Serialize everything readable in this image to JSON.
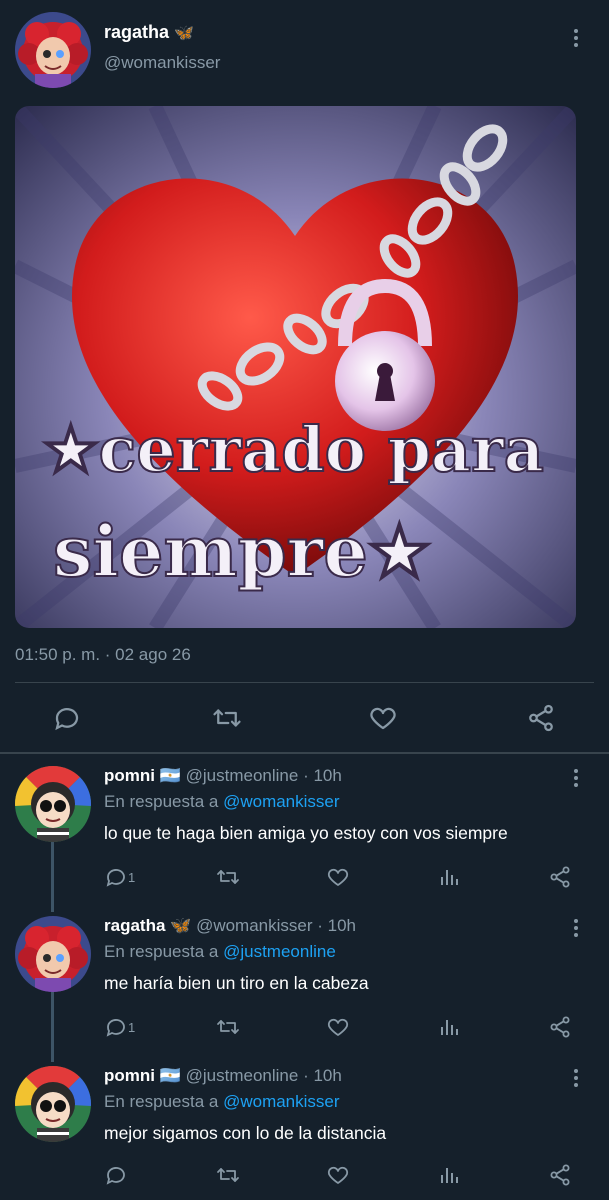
{
  "main_tweet": {
    "display_name": "ragatha",
    "name_emoji": "🦋",
    "handle": "@womankisser",
    "image": {
      "alt_text_line1": "★cerrado para",
      "alt_text_line2": "siempre★"
    },
    "timestamp": "01:50 p. m. · 02 ago 26",
    "actions": [
      "comment-icon",
      "retweet-icon",
      "like-icon",
      "share-icon"
    ]
  },
  "replies": [
    {
      "display_name": "pomni",
      "name_emoji": "🇦🇷",
      "handle": "@justmeonline · 10h",
      "reply_prefix": "En respuesta a ",
      "reply_to": "@womankisser",
      "text": "lo que te haga bien amiga yo estoy con vos siempre",
      "reply_count": "1"
    },
    {
      "display_name": "ragatha",
      "name_emoji": "🦋",
      "handle": "@womankisser · 10h",
      "reply_prefix": "En respuesta a ",
      "reply_to": "@justmeonline",
      "text": "me haría bien un tiro en la cabeza",
      "reply_count": "1"
    },
    {
      "display_name": "pomni",
      "name_emoji": "🇦🇷",
      "handle": "@justmeonline · 10h",
      "reply_prefix": "En respuesta a ",
      "reply_to": "@womankisser",
      "text": "mejor sigamos con lo de la distancia",
      "reply_count": ""
    }
  ],
  "colors": {
    "background": "#15202b",
    "secondary_text": "#8899a6",
    "mention": "#1da1f2",
    "divider": "#38444d"
  }
}
